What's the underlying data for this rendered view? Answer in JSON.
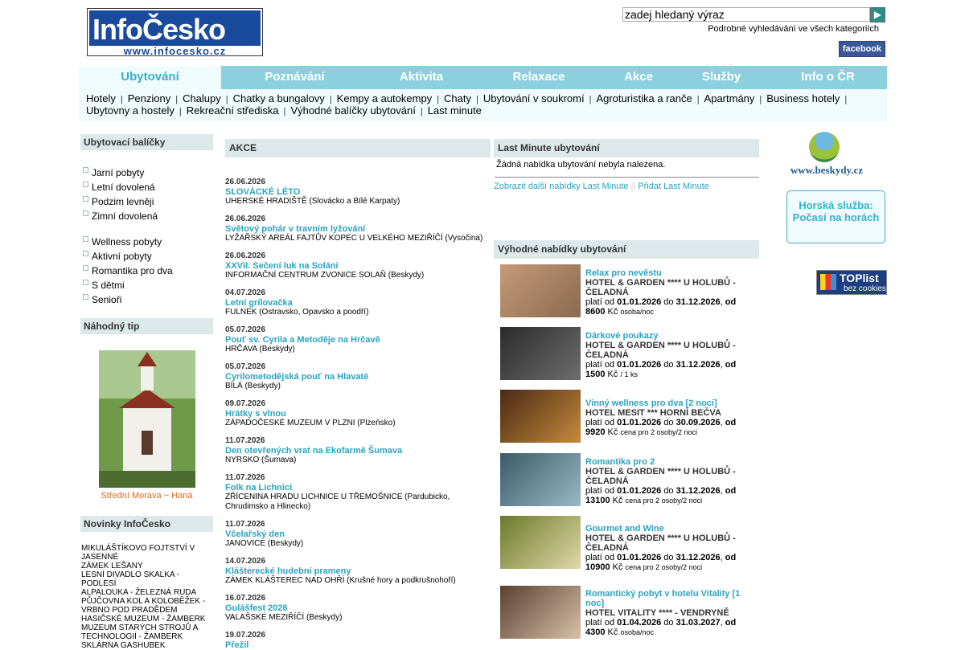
{
  "header": {
    "logo_text": "InfoČesko",
    "logo_url": "www.infocesko.cz",
    "search_placeholder": "zadej hledaný výraz",
    "advanced_search": "Podrobné vyhledávání ve všech kategoriích",
    "facebook": "facebook"
  },
  "nav": [
    "Ubytování",
    "Poznávání",
    "Aktivita",
    "Relaxace",
    "Akce",
    "Služby",
    "Info o ČR"
  ],
  "subnav": {
    "row1": [
      "Hotely",
      "Penziony",
      "Chalupy",
      "Chatky a bungalovy",
      "Kempy a autokempy",
      "Chaty",
      "Ubytování v soukromí",
      "Agroturistika a ranče",
      "Apartmány",
      "Business hotely"
    ],
    "row2": [
      "Ubytovny a hostely",
      "Rekreační střediska",
      "Výhodné balíčky ubytování",
      "Last minute"
    ]
  },
  "left": {
    "packages_title": "Ubytovací balíčky",
    "group1": [
      "Jarní pobyty",
      "Letní dovolená",
      "Podzim levněji",
      "Zimní dovolená"
    ],
    "group2": [
      "Wellness pobyty",
      "Aktivní pobyty",
      "Romantika pro dva",
      "S dětmi",
      "Senioři"
    ],
    "tip_title": "Náhodný tip",
    "tip_caption": "Střední Morava ~ Haná",
    "news_title": "Novinky InfoČesko",
    "news": [
      "MIKULÁŠTÍKOVO FOJTSTVÍ V JASENNÉ",
      "ZÁMEK LEŠANY",
      "LESNÍ DIVADLO SKALKA - PODLESÍ",
      "ALPALOUKA - ŽELEZNÁ RUDA",
      "PŮJČOVNA KOL A KOLOBĚŽEK - VRBNO POD PRADĚDEM",
      "HASIČSKÉ MUZEUM - ŽAMBERK",
      "MUZEUM STARÝCH STROJŮ A TECHNOLOGIÍ - ŽAMBERK",
      "SKLÁRNA GASHUBEK"
    ]
  },
  "events": {
    "title": "AKCE",
    "items": [
      {
        "date": "26.06.2026",
        "name": "SLOVÁCKÉ LÉTO",
        "place": "UHERSKÉ HRADIŠTĚ (Slovácko a Bílé Karpaty)"
      },
      {
        "date": "26.06.2026",
        "name": "Světový pohár v travním lyžování",
        "place": "LYŽAŘSKÝ AREÁL FAJTŮV KOPEC U VELKÉHO MEZIŘÍČÍ (Vysočina)"
      },
      {
        "date": "26.06.2026",
        "name": "XXVII. Sečení luk na Soláni",
        "place": "INFORMAČNÍ CENTRUM ZVONICE SOLAŇ (Beskydy)"
      },
      {
        "date": "04.07.2026",
        "name": "Letní grilovačka",
        "place": "FULNEK (Ostravsko, Opavsko a poodří)"
      },
      {
        "date": "05.07.2026",
        "name": "Pouť sv. Cyrila a Metoděje na Hrčavě",
        "place": "HRČAVA (Beskydy)"
      },
      {
        "date": "05.07.2026",
        "name": "Cyrilometodějská pouť na Hlavaté",
        "place": "BÍLÁ (Beskydy)"
      },
      {
        "date": "09.07.2026",
        "name": "Hrátky s vlnou",
        "place": "ZÁPADOČESKÉ MUZEUM V PLZNI (Plzeňsko)"
      },
      {
        "date": "11.07.2026",
        "name": "Den otevřených vrat na Ekofarmě Šumava",
        "place": "NYRSKO (Šumava)"
      },
      {
        "date": "11.07.2026",
        "name": "Folk na Lichnici",
        "place": "ZŘÍCENINA HRADU LICHNICE U TŘEMOŠNICE (Pardubicko, Chrudimsko a Hlinecko)"
      },
      {
        "date": "11.07.2026",
        "name": "Včelařský den",
        "place": "JANOVICE (Beskydy)"
      },
      {
        "date": "14.07.2026",
        "name": "Klášterecké hudební prameny",
        "place": "ZÁMEK KLÁŠTEREC NAD OHŘÍ (Krušné hory a podkrušnohoří)"
      },
      {
        "date": "16.07.2026",
        "name": "Gulášfest 2026",
        "place": "VALAŠSKÉ MEZIŘÍČÍ (Beskydy)"
      },
      {
        "date": "19.07.2026",
        "name": "Přežil",
        "place": ""
      }
    ]
  },
  "lastminute": {
    "title": "Last Minute ubytování",
    "empty": "Žádná nabídka ubytování nebyla nalezena.",
    "more": "Zobrazit další nabídky Last Minute",
    "add": "Přidat Last Minute"
  },
  "offers": {
    "title": "Výhodné nabídky ubytování",
    "price_label": "platí od",
    "to_label": "do",
    "from_label": "od",
    "currency": "Kč",
    "items": [
      {
        "name": "Relax pro nevěstu",
        "hotel": "HOTEL & GARDEN **** U HOLUBŮ - ČELADNÁ",
        "from": "01.01.2026",
        "to": "31.12.2026",
        "price": "8600",
        "unit": "osoba/noc"
      },
      {
        "name": "Dárkové poukazy",
        "hotel": "HOTEL & GARDEN **** U HOLUBŮ - ČELADNÁ",
        "from": "01.01.2026",
        "to": "31.12.2026",
        "price": "1500",
        "unit": "/ 1 ks"
      },
      {
        "name": "Vinný wellness pro dva [2 noci]",
        "hotel": "HOTEL MESIT *** HORNÍ BEČVA",
        "from": "01.01.2026",
        "to": "30.09.2026",
        "price": "9920",
        "unit": "cena pro 2 osoby/2 noci"
      },
      {
        "name": "Romantika pro 2",
        "hotel": "HOTEL & GARDEN **** U HOLUBŮ - ČELADNÁ",
        "from": "01.01.2026",
        "to": "31.12.2026",
        "price": "13100",
        "unit": "cena pro 2 osoby/2 noci"
      },
      {
        "name": "Gourmet and Wine",
        "hotel": "HOTEL & GARDEN **** U HOLUBŮ - ČELADNÁ",
        "from": "01.01.2026",
        "to": "31.12.2026",
        "price": "10900",
        "unit": "cena pro 2 osoby/2 noci"
      },
      {
        "name": "Romantický pobyt v hotelu Vitality [1 noc]",
        "hotel": "HOTEL VITALITY **** - VENDRYNĚ",
        "from": "01.04.2026",
        "to": "31.03.2027",
        "price": "4300",
        "unit": "osoba/noc"
      }
    ]
  },
  "sidebar": {
    "beskydy": "www.beskydy.cz",
    "horska": "Horská služba: Počasí na horách",
    "toplist": "TOPlist",
    "toplist_sub": "bez cookies"
  },
  "colors": {
    "accent": "#34b1cb",
    "nav_bg": "#8cd0de",
    "link": "#2aa3c0",
    "tip_caption": "#d86a1a"
  }
}
